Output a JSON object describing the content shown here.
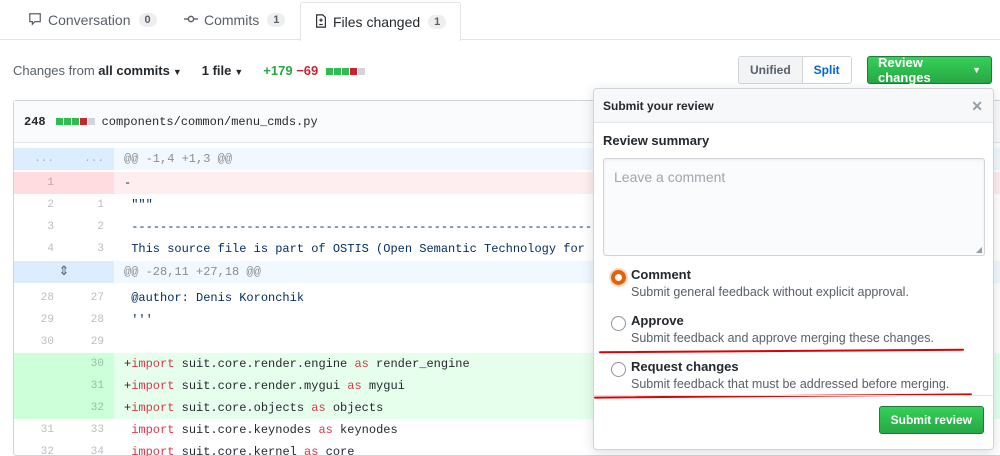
{
  "tabs": [
    {
      "label": "Conversation",
      "count": "0",
      "icon": "comment-icon"
    },
    {
      "label": "Commits",
      "count": "1",
      "icon": "commit-icon"
    },
    {
      "label": "Files changed",
      "count": "1",
      "icon": "file-diff-icon"
    }
  ],
  "toolbar": {
    "changes_prefix": "Changes from",
    "changes_value": "all commits",
    "files_label": "1 file",
    "additions": "+179",
    "deletions": "−69",
    "unified_label": "Unified",
    "split_label": "Split",
    "review_label": "Review changes"
  },
  "file": {
    "count": "248",
    "path": "components/common/menu_cmds.py"
  },
  "diff": {
    "hunk1": {
      "l": "...",
      "r": "...",
      "text": "@@ -1,4 +1,3 @@"
    },
    "rows": [
      {
        "l": "1",
        "r": "",
        "text": "-"
      },
      {
        "l": "2",
        "r": "1",
        "text": " \"\"\""
      },
      {
        "l": "3",
        "r": "2",
        "text": " ---------------------------------------------------------------------------------------"
      },
      {
        "l": "4",
        "r": "3",
        "text": " This source file is part of OSTIS (Open Semantic Technology for In"
      }
    ],
    "hunk2": {
      "text": "@@ -28,11 +27,18 @@"
    },
    "rows2": [
      {
        "l": "28",
        "r": "27",
        "text": " @author: Denis Koronchik"
      },
      {
        "l": "29",
        "r": "28",
        "text": " '''"
      },
      {
        "l": "30",
        "r": "29",
        "text": ""
      }
    ],
    "adds": [
      {
        "r": "30",
        "pre": "+",
        "kw1": "import",
        "mid": " suit.core.render.engine ",
        "kw2": "as",
        "post": " render_engine"
      },
      {
        "r": "31",
        "pre": "+",
        "kw1": "import",
        "mid": " suit.core.render.mygui ",
        "kw2": "as",
        "post": " mygui"
      },
      {
        "r": "32",
        "pre": "+",
        "kw1": "import",
        "mid": " suit.core.objects ",
        "kw2": "as",
        "post": " objects"
      }
    ],
    "tail": [
      {
        "l": "31",
        "r": "33",
        "pre": " ",
        "kw1": "import",
        "mid": " suit.core.keynodes ",
        "kw2": "as",
        "post": " keynodes"
      },
      {
        "l": "32",
        "r": "34",
        "pre": " ",
        "kw1": "import",
        "mid": " suit.core.kernel ",
        "kw2": "as",
        "post": " core"
      }
    ]
  },
  "review": {
    "title": "Submit your review",
    "summary_label": "Review summary",
    "placeholder": "Leave a comment",
    "options": [
      {
        "title": "Comment",
        "desc": "Submit general feedback without explicit approval.",
        "checked": true
      },
      {
        "title": "Approve",
        "desc": "Submit feedback and approve merging these changes.",
        "checked": false
      },
      {
        "title": "Request changes",
        "desc": "Submit feedback that must be addressed before merging.",
        "checked": false
      }
    ],
    "submit_label": "Submit review"
  },
  "colors": {
    "accent_green": "#28a745",
    "deletion_red": "#cb2431",
    "link_blue": "#0366d6",
    "annotation_red": "#e00000"
  }
}
